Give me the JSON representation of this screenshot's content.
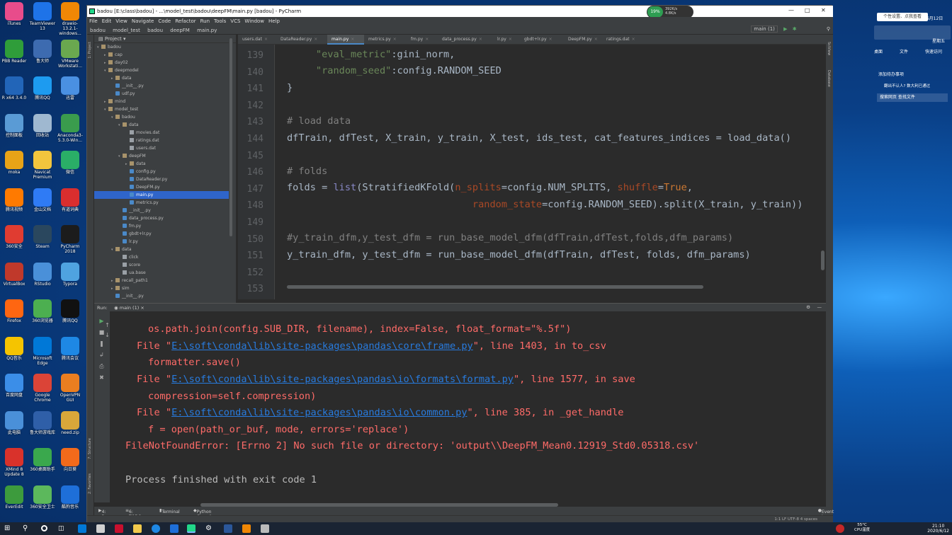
{
  "window": {
    "title": "badou [E:\\class\\badou] - ...\\model_test\\badou\\deepFM\\main.py [badou] - PyCharm",
    "cpu_percent": "19%",
    "net_up": "392K/s",
    "net_down": "4.8K/s"
  },
  "menu": [
    "File",
    "Edit",
    "View",
    "Navigate",
    "Code",
    "Refactor",
    "Run",
    "Tools",
    "VCS",
    "Window",
    "Help"
  ],
  "breadcrumb": [
    "badou",
    "model_test",
    "badou",
    "deepFM",
    "main.py"
  ],
  "run_config": "main (1)",
  "project_panel": {
    "title": "Project",
    "tree": [
      {
        "label": "badou",
        "depth": 0,
        "type": "folder",
        "open": true
      },
      {
        "label": "cap",
        "depth": 1,
        "type": "folder",
        "open": false
      },
      {
        "label": "day02",
        "depth": 1,
        "type": "folder",
        "open": false
      },
      {
        "label": "deepmodel",
        "depth": 1,
        "type": "folder",
        "open": true
      },
      {
        "label": "data",
        "depth": 2,
        "type": "folder",
        "open": false
      },
      {
        "label": "__init__.py",
        "depth": 2,
        "type": "py"
      },
      {
        "label": "udf.py",
        "depth": 2,
        "type": "py"
      },
      {
        "label": "mind",
        "depth": 1,
        "type": "folder",
        "open": false
      },
      {
        "label": "model_test",
        "depth": 1,
        "type": "folder",
        "open": true
      },
      {
        "label": "badou",
        "depth": 2,
        "type": "folder",
        "open": true
      },
      {
        "label": "data",
        "depth": 3,
        "type": "folder",
        "open": true
      },
      {
        "label": "movies.dat",
        "depth": 4,
        "type": "dat"
      },
      {
        "label": "ratings.dat",
        "depth": 4,
        "type": "dat"
      },
      {
        "label": "users.dat",
        "depth": 4,
        "type": "dat"
      },
      {
        "label": "deepFM",
        "depth": 3,
        "type": "folder",
        "open": true
      },
      {
        "label": "data",
        "depth": 4,
        "type": "folder",
        "open": false
      },
      {
        "label": "config.py",
        "depth": 4,
        "type": "py"
      },
      {
        "label": "DataReader.py",
        "depth": 4,
        "type": "py"
      },
      {
        "label": "DeepFM.py",
        "depth": 4,
        "type": "py"
      },
      {
        "label": "main.py",
        "depth": 4,
        "type": "py",
        "selected": true
      },
      {
        "label": "metrics.py",
        "depth": 4,
        "type": "py"
      },
      {
        "label": "__init__.py",
        "depth": 3,
        "type": "py"
      },
      {
        "label": "data_process.py",
        "depth": 3,
        "type": "py"
      },
      {
        "label": "fm.py",
        "depth": 3,
        "type": "py"
      },
      {
        "label": "gbdt+lr.py",
        "depth": 3,
        "type": "py"
      },
      {
        "label": "lr.py",
        "depth": 3,
        "type": "py"
      },
      {
        "label": "data",
        "depth": 2,
        "type": "folder",
        "open": true
      },
      {
        "label": "click",
        "depth": 3,
        "type": "dat"
      },
      {
        "label": "score",
        "depth": 3,
        "type": "dat"
      },
      {
        "label": "ua.base",
        "depth": 3,
        "type": "dat"
      },
      {
        "label": "recall_path1",
        "depth": 2,
        "type": "folder",
        "open": false
      },
      {
        "label": "sim",
        "depth": 2,
        "type": "folder",
        "open": false
      },
      {
        "label": "__init__.py",
        "depth": 2,
        "type": "py"
      }
    ]
  },
  "tabs": [
    "users.dat",
    "DataReader.py",
    "main.py",
    "metrics.py",
    "fm.py",
    "data_process.py",
    "lr.py",
    "gbdt+lr.py",
    "DeepFM.py",
    "ratings.dat"
  ],
  "active_tab": "main.py",
  "editor": {
    "line_numbers": [
      "139",
      "140",
      "141",
      "142",
      "143",
      "144",
      "145",
      "146",
      "147",
      "148",
      "149",
      "150",
      "151",
      "152",
      "153"
    ],
    "l139_key": "\"eval_metric\"",
    "l139_rest": ":gini_norm,",
    "l140_key": "\"random_seed\"",
    "l140_rest": ":config.RANDOM_SEED",
    "l141": "}",
    "l143": "# load data",
    "l144": "dfTrain, dfTest, X_train, y_train, X_test, ids_test, cat_features_indices = load_data()",
    "l146": "# folds",
    "l147_a": "folds = ",
    "l147_b": "list",
    "l147_c": "(StratifiedKFold(",
    "l147_d": "n_splits",
    "l147_e": "=config.NUM_SPLITS, ",
    "l147_f": "shuffle",
    "l147_g": "=",
    "l147_h": "True",
    "l147_i": ",",
    "l148_a": "random_state",
    "l148_b": "=config.RANDOM_SEED).split(X_train, y_train))",
    "l150": "#y_train_dfm,y_test_dfm = run_base_model_dfm(dfTrain,dfTest,folds,dfm_params)",
    "l151": "y_train_dfm, y_test_dfm = run_base_model_dfm(dfTrain, dfTest, folds, dfm_params)"
  },
  "run_panel": {
    "label": "Run:",
    "tab": "main (1)",
    "out1": "os.path.join(config.SUB_DIR, filename), index=False, float_format=\"%.5f\")",
    "f1_pre": "File \"",
    "f1_path": "E:\\soft\\conda\\lib\\site-packages\\pandas\\core\\frame.py",
    "f1_post": "\", line 1403, in to_csv",
    "out2": "formatter.save()",
    "f2_pre": "File \"",
    "f2_path": "E:\\soft\\conda\\lib\\site-packages\\pandas\\io\\formats\\format.py",
    "f2_post": "\", line 1577, in save",
    "out3": "compression=self.compression)",
    "f3_pre": "File \"",
    "f3_path": "E:\\soft\\conda\\lib\\site-packages\\pandas\\io\\common.py",
    "f3_post": "\", line 385, in _get_handle",
    "out4": "f = open(path_or_buf, mode, errors='replace')",
    "error": "FileNotFoundError: [Errno 2] No such file or directory: 'output\\\\DeepFM_Mean0.12919_Std0.05318.csv'",
    "exit": "Process finished with exit code 1"
  },
  "bottom_tabs": [
    "4: Run",
    "6: TODO",
    "Terminal",
    "Python Console"
  ],
  "event_log": "Event Log",
  "status": "1:1  LF  UTF-8  4 spaces",
  "desktop_icons": [
    {
      "label": "iTunes",
      "color": "#e84c8b"
    },
    {
      "label": "TeamViewer 13",
      "color": "#1e73e8"
    },
    {
      "label": "drawio-13.2.1-windows...",
      "color": "#f08705"
    },
    {
      "label": "PBB Reader",
      "color": "#2f9d3a"
    },
    {
      "label": "鲁大师",
      "color": "#3d6bb0"
    },
    {
      "label": "VMware Workstati...",
      "color": "#6aa84f"
    },
    {
      "label": "R x64 3.4.0",
      "color": "#2265b8"
    },
    {
      "label": "腾讯QQ",
      "color": "#1d9bf0"
    },
    {
      "label": "迅雷",
      "color": "#4a90e2"
    },
    {
      "label": "控制面板",
      "color": "#5a9bd5"
    },
    {
      "label": "回收站",
      "color": "#9fb8d0"
    },
    {
      "label": "Anaconda3-5.3.0-Win...",
      "color": "#3a9c4d"
    },
    {
      "label": "moka",
      "color": "#e8a317"
    },
    {
      "label": "Navicat Premium",
      "color": "#f2c53d"
    },
    {
      "label": "微信",
      "color": "#2aae67"
    },
    {
      "label": "腾讯视频",
      "color": "#ff7a00"
    },
    {
      "label": "金山文档",
      "color": "#2f7bf5"
    },
    {
      "label": "有道词典",
      "color": "#d92e2e"
    },
    {
      "label": "360安全",
      "color": "#e03c31"
    },
    {
      "label": "Steam",
      "color": "#2a475e"
    },
    {
      "label": "PyCharm 2018",
      "color": "#1c1c1c"
    },
    {
      "label": "VirtualBox",
      "color": "#c0392b"
    },
    {
      "label": "RStudio",
      "color": "#4a90d9"
    },
    {
      "label": "Typora",
      "color": "#4fa3e0"
    },
    {
      "label": "Firefox",
      "color": "#ff6611"
    },
    {
      "label": "360浏览器",
      "color": "#4caf50"
    },
    {
      "label": "腾讯QQ",
      "color": "#111111"
    },
    {
      "label": "QQ音乐",
      "color": "#f5c400"
    },
    {
      "label": "Microsoft Edge",
      "color": "#0078d7"
    },
    {
      "label": "腾讯会议",
      "color": "#1e88e5"
    },
    {
      "label": "百度网盘",
      "color": "#3b8ee8"
    },
    {
      "label": "Google Chrome",
      "color": "#db4437"
    },
    {
      "label": "OpenVPN GUI",
      "color": "#ea7e20"
    },
    {
      "label": "此电脑",
      "color": "#4a90d9"
    },
    {
      "label": "鲁大师游戏库",
      "color": "#2f5fa8"
    },
    {
      "label": "need.zip",
      "color": "#d8a73a"
    },
    {
      "label": "XMind 8 Update 8",
      "color": "#d9322b"
    },
    {
      "label": "360桌面助手",
      "color": "#3aa84d"
    },
    {
      "label": "向日葵",
      "color": "#f26a1b"
    },
    {
      "label": "EverEdit",
      "color": "#3d9b3d"
    },
    {
      "label": "360安全卫士",
      "color": "#5cb85c"
    },
    {
      "label": "酷狗音乐",
      "color": "#1e6fd9"
    }
  ],
  "side_widget": {
    "top": "个性设置、点我查看",
    "date": "06月12日",
    "weekday": "星期五",
    "items": [
      "桌面",
      "文件",
      "快速访问"
    ],
    "todo": "添加待办事项",
    "notice": "翻出不认人? 数大利已通过",
    "search": "搜索网页   查找文件"
  },
  "tray": {
    "temp": "55°C",
    "cpu_label": "CPU温度",
    "time": "21:10",
    "date": "2020/6/12"
  }
}
